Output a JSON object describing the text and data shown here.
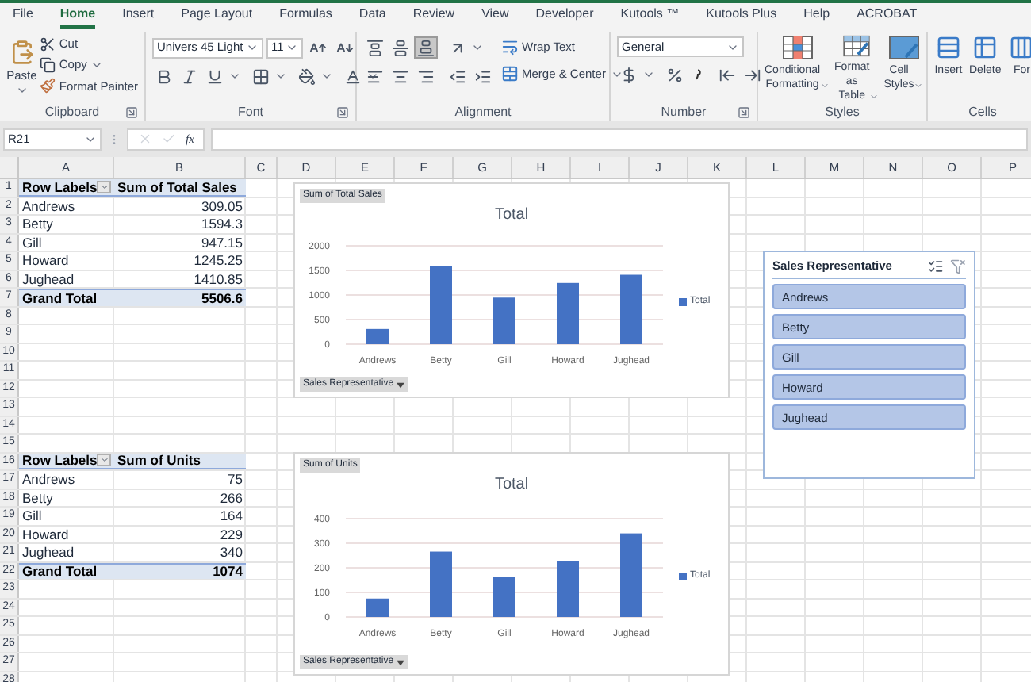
{
  "tabs": [
    {
      "label": "File",
      "selected": false
    },
    {
      "label": "Home",
      "selected": true
    },
    {
      "label": "Insert",
      "selected": false
    },
    {
      "label": "Page Layout",
      "selected": false
    },
    {
      "label": "Formulas",
      "selected": false
    },
    {
      "label": "Data",
      "selected": false
    },
    {
      "label": "Review",
      "selected": false
    },
    {
      "label": "View",
      "selected": false
    },
    {
      "label": "Developer",
      "selected": false
    },
    {
      "label": "Kutools ™",
      "selected": false
    },
    {
      "label": "Kutools Plus",
      "selected": false
    },
    {
      "label": "Help",
      "selected": false
    },
    {
      "label": "ACROBAT",
      "selected": false
    }
  ],
  "clipboard": {
    "label": "Clipboard",
    "paste": "Paste",
    "cut": "Cut",
    "copy": "Copy",
    "format_painter": "Format Painter"
  },
  "font": {
    "label": "Font",
    "name": "Univers 45 Light",
    "size": "11"
  },
  "alignment": {
    "label": "Alignment",
    "vertical": [
      {
        "selected": false
      },
      {
        "selected": false
      },
      {
        "selected": true
      }
    ],
    "wrap_text": "Wrap Text",
    "merge": "Merge & Center"
  },
  "number": {
    "label": "Number",
    "format": "General"
  },
  "styles": {
    "label": "Styles",
    "buttons": [
      "Conditional Formatting",
      "Format as Table",
      "Cell Styles"
    ]
  },
  "cells": {
    "label": "Cells",
    "buttons": [
      "Insert",
      "Delete",
      "For"
    ]
  },
  "formula_bar": {
    "name_box": "R21",
    "function_label": "fx"
  },
  "sheet": {
    "columns": [
      "A",
      "B",
      "C",
      "D",
      "E",
      "F",
      "G",
      "H",
      "I",
      "J",
      "K",
      "L",
      "M",
      "N",
      "O",
      "P"
    ],
    "rows": [
      {
        "number": "1",
        "kind": "pivot_header",
        "cells": [
          "Row Labels",
          "Sum of Total Sales"
        ]
      },
      {
        "number": "2",
        "kind": "pivot_item",
        "cells": [
          "Andrews",
          "309.05"
        ]
      },
      {
        "number": "3",
        "kind": "pivot_item",
        "cells": [
          "Betty",
          "1594.3"
        ]
      },
      {
        "number": "4",
        "kind": "pivot_item",
        "cells": [
          "Gill",
          "947.15"
        ]
      },
      {
        "number": "5",
        "kind": "pivot_item",
        "cells": [
          "Howard",
          "1245.25"
        ]
      },
      {
        "number": "6",
        "kind": "pivot_item",
        "cells": [
          "Jughead",
          "1410.85"
        ]
      },
      {
        "number": "7",
        "kind": "pivot_total",
        "cells": [
          "Grand Total",
          "5506.6"
        ]
      },
      {
        "number": "8",
        "kind": "empty"
      },
      {
        "number": "9",
        "kind": "empty"
      },
      {
        "number": "10",
        "kind": "empty"
      },
      {
        "number": "11",
        "kind": "empty"
      },
      {
        "number": "12",
        "kind": "empty"
      },
      {
        "number": "13",
        "kind": "empty"
      },
      {
        "number": "14",
        "kind": "empty"
      },
      {
        "number": "15",
        "kind": "empty"
      },
      {
        "number": "16",
        "kind": "pivot_header",
        "cells": [
          "Row Labels",
          "Sum of Units"
        ]
      },
      {
        "number": "17",
        "kind": "pivot_item",
        "cells": [
          "Andrews",
          "75"
        ]
      },
      {
        "number": "18",
        "kind": "pivot_item",
        "cells": [
          "Betty",
          "266"
        ]
      },
      {
        "number": "19",
        "kind": "pivot_item",
        "cells": [
          "Gill",
          "164"
        ]
      },
      {
        "number": "20",
        "kind": "pivot_item",
        "cells": [
          "Howard",
          "229"
        ]
      },
      {
        "number": "21",
        "kind": "pivot_item",
        "cells": [
          "Jughead",
          "340"
        ]
      },
      {
        "number": "22",
        "kind": "pivot_total",
        "cells": [
          "Grand Total",
          "1074"
        ]
      },
      {
        "number": "23",
        "kind": "empty"
      },
      {
        "number": "24",
        "kind": "empty"
      },
      {
        "number": "25",
        "kind": "empty"
      },
      {
        "number": "26",
        "kind": "empty"
      },
      {
        "number": "27",
        "kind": "empty"
      },
      {
        "number": "28",
        "kind": "empty"
      }
    ]
  },
  "charts": [
    {
      "field_button": "Sum of Total Sales",
      "axis_button": "Sales Representative",
      "chart_data": {
        "type": "bar",
        "title": "Total",
        "categories": [
          "Andrews",
          "Betty",
          "Gill",
          "Howard",
          "Jughead"
        ],
        "series": [
          {
            "name": "Total",
            "color": "#4472c4",
            "values": [
              309,
              1594,
              947,
              1245,
              1411
            ]
          }
        ],
        "ylim": [
          0,
          2000
        ],
        "yticks": [
          0,
          500,
          1000,
          1500,
          2000
        ],
        "grid": true
      }
    },
    {
      "field_button": "Sum of Units",
      "axis_button": "Sales Representative",
      "chart_data": {
        "type": "bar",
        "title": "Total",
        "categories": [
          "Andrews",
          "Betty",
          "Gill",
          "Howard",
          "Jughead"
        ],
        "series": [
          {
            "name": "Total",
            "color": "#4472c4",
            "values": [
              75,
              266,
              164,
              229,
              340
            ]
          }
        ],
        "ylim": [
          0,
          400
        ],
        "yticks": [
          0,
          100,
          200,
          300,
          400
        ],
        "grid": true
      }
    }
  ],
  "slicer": {
    "title": "Sales Representative",
    "items": [
      {
        "label": "Andrews",
        "selected": true
      },
      {
        "label": "Betty",
        "selected": true
      },
      {
        "label": "Gill",
        "selected": true
      },
      {
        "label": "Howard",
        "selected": true
      },
      {
        "label": "Jughead",
        "selected": true
      }
    ]
  }
}
